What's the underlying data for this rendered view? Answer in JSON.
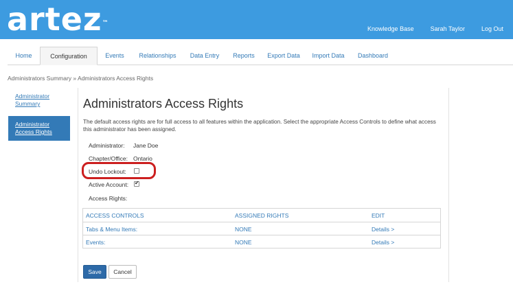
{
  "header": {
    "logo_text": "artez",
    "logo_mark": "™",
    "links": [
      "Knowledge Base",
      "Sarah Taylor",
      "Log Out"
    ]
  },
  "tabs": [
    {
      "label": "Home",
      "active": false
    },
    {
      "label": "Configuration",
      "active": true
    },
    {
      "label": "Events",
      "active": false
    },
    {
      "label": "Relationships",
      "active": false
    },
    {
      "label": "Data Entry",
      "active": false
    },
    {
      "label": "Reports",
      "active": false
    },
    {
      "label": "Export Data",
      "active": false
    },
    {
      "label": "Import Data",
      "active": false
    },
    {
      "label": "Dashboard",
      "active": false
    }
  ],
  "breadcrumb": "Administrators Summary » Administrators Access Rights",
  "sidebar": {
    "items": [
      {
        "label": "Administrator Summary",
        "active": false
      },
      {
        "label": "Administrator Access Rights",
        "active": true
      }
    ]
  },
  "main": {
    "title": "Administrators Access Rights",
    "description": "The default access rights are for full access to all features within the application. Select the appropriate Access Controls to define what access this administrator has been assigned.",
    "fields": {
      "administrator_label": "Administrator:",
      "administrator_value": "Jane Doe",
      "chapter_label": "Chapter/Office:",
      "chapter_value": "Ontario",
      "undo_lockout_label": "Undo Lockout:",
      "undo_lockout_checked": false,
      "active_account_label": "Active Account:",
      "active_account_checked": true,
      "access_rights_label": "Access Rights:"
    },
    "highlight_color": "#cc1f1f",
    "table": {
      "headers": [
        "ACCESS CONTROLS",
        "ASSIGNED RIGHTS",
        "EDIT"
      ],
      "rows": [
        [
          "Tabs & Menu Items:",
          "NONE",
          "Details >"
        ],
        [
          "Events:",
          "NONE",
          "Details >"
        ]
      ]
    },
    "buttons": {
      "save": "Save",
      "cancel": "Cancel"
    }
  },
  "colors": {
    "header_bg": "#3d9be0",
    "link": "#337ab7",
    "active_sidebar": "#337ab7",
    "save_button": "#2d6aa8"
  }
}
